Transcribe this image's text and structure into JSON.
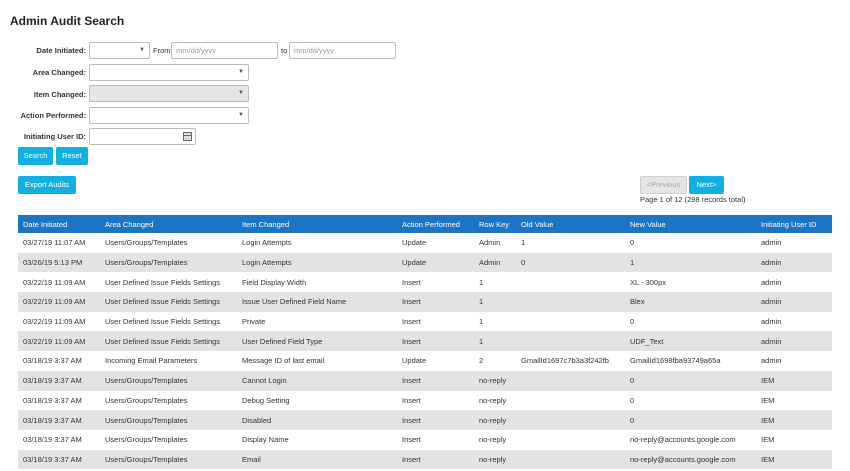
{
  "page": {
    "title": "Admin Audit Search"
  },
  "filters": {
    "date_initiated_label": "Date Initiated:",
    "date_initiated_select": "",
    "from_label": "From",
    "to_label": "to",
    "from_placeholder": "mm/dd/yyyy",
    "to_placeholder": "mm/dd/yyyy",
    "area_changed_label": "Area Changed:",
    "item_changed_label": "Item Changed:",
    "action_performed_label": "Action Performed:",
    "initiating_user_label": "Initiating User ID:",
    "dropdown_caret": "▼"
  },
  "buttons": {
    "search": "Search",
    "reset": "Reset",
    "export": "Export Audits",
    "previous": "<Previous",
    "next": "Next>"
  },
  "pagination": {
    "info": "Page 1 of 12 (298 records total)"
  },
  "table": {
    "headers": [
      "Date Initiated",
      "Area Changed",
      "Item Changed",
      "Action Performed",
      "Row Key",
      "Old Value",
      "New Value",
      "Initiating User ID"
    ],
    "rows": [
      [
        "03/27/19 11:07 AM",
        "Users/Groups/Templates",
        "Login Attempts",
        "Update",
        "Admin",
        "1",
        "0",
        "admin"
      ],
      [
        "03/26/19 5:13 PM",
        "Users/Groups/Templates",
        "Login Attempts",
        "Update",
        "Admin",
        "0",
        "1",
        "admin"
      ],
      [
        "03/22/19 11:09 AM",
        "User Defined Issue Fields Settings",
        "Field Display Width",
        "Insert",
        "1",
        "",
        "XL - 300px",
        "admin"
      ],
      [
        "03/22/19 11:09 AM",
        "User Defined Issue Fields Settings",
        "Issue User Defined Field Name",
        "Insert",
        "1",
        "",
        "Blex",
        "admin"
      ],
      [
        "03/22/19 11:09 AM",
        "User Defined Issue Fields Settings",
        "Private",
        "Insert",
        "1",
        "",
        "0",
        "admin"
      ],
      [
        "03/22/19 11:09 AM",
        "User Defined Issue Fields Settings",
        "User Defined Field Type",
        "Insert",
        "1",
        "",
        "UDF_Text",
        "admin"
      ],
      [
        "03/18/19 3:37 AM",
        "Incoming Email Parameters",
        "Message ID of last email",
        "Update",
        "2",
        "GmailId1697c7b3a3f242fb",
        "GmailId1698fba93749a65a",
        "admin"
      ],
      [
        "03/18/19 3:37 AM",
        "Users/Groups/Templates",
        "Cannot Login",
        "Insert",
        "no-reply",
        "",
        "0",
        "IEM"
      ],
      [
        "03/18/19 3:37 AM",
        "Users/Groups/Templates",
        "Debug Setting",
        "Insert",
        "no-reply",
        "",
        "0",
        "IEM"
      ],
      [
        "03/18/19 3:37 AM",
        "Users/Groups/Templates",
        "Disabled",
        "Insert",
        "no-reply",
        "",
        "0",
        "IEM"
      ],
      [
        "03/18/19 3:37 AM",
        "Users/Groups/Templates",
        "Display Name",
        "Insert",
        "no-reply",
        "",
        "no-reply@accounts.google.com",
        "IEM"
      ],
      [
        "03/18/19 3:37 AM",
        "Users/Groups/Templates",
        "Email",
        "Insert",
        "no-reply",
        "",
        "no-reply@accounts.google.com",
        "IEM"
      ]
    ]
  },
  "colors": {
    "accent": "#12b0e0",
    "header": "#1c75c4",
    "row_alt": "#e3e3e3"
  }
}
